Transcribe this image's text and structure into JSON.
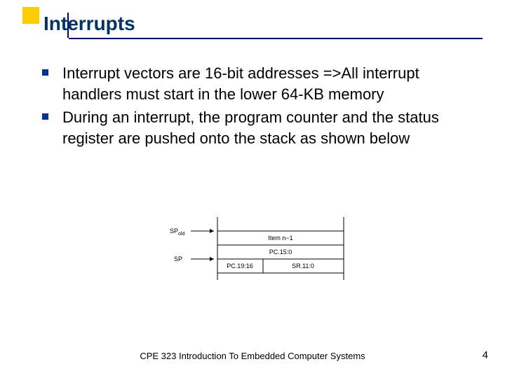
{
  "title": "Interrupts",
  "bullets": [
    "Interrupt vectors are 16-bit addresses =>All interrupt handlers must start in the lower 64-KB memory",
    "During an interrupt, the program counter and the status register are pushed onto the stack as shown below"
  ],
  "diagram": {
    "sp_old": "SP",
    "sp_old_sub": "old",
    "sp": "SP",
    "row1": "Item n−1",
    "row2": "PC.15:0",
    "row3_left": "PC.19:16",
    "row3_right": "SR.11:0"
  },
  "footer": "CPE 323 Introduction To Embedded Computer Systems",
  "page": "4"
}
